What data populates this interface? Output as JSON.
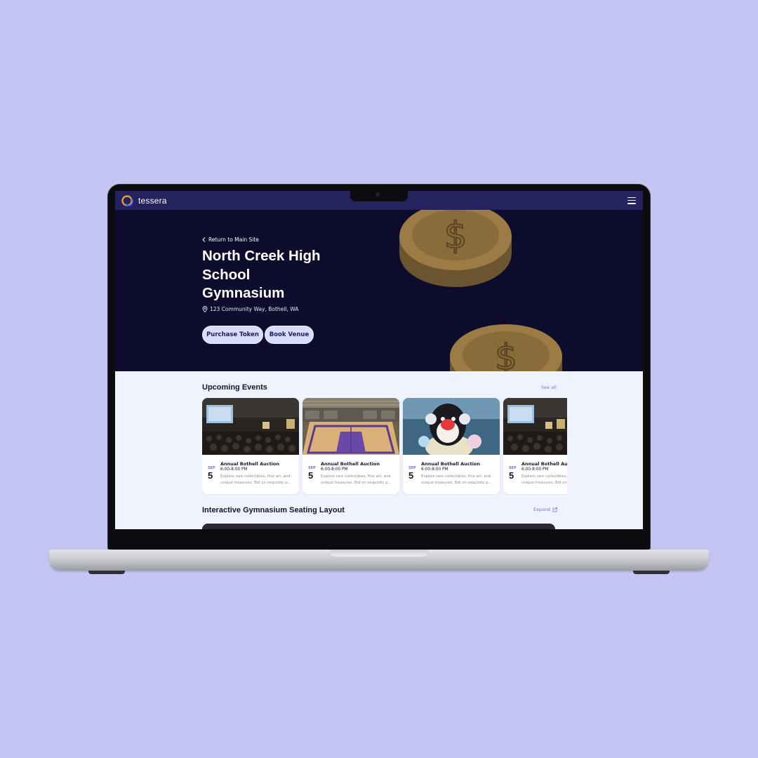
{
  "brand": {
    "name": "tessera"
  },
  "hero": {
    "back_link": "Return to Main Site",
    "title": "North Creek High School Gymnasium",
    "address": "123 Community Way, Bothell, WA",
    "buttons": {
      "purchase_token": "Purchase Token",
      "book_venue": "Book Venue"
    }
  },
  "events": {
    "heading": "Upcoming Events",
    "see_all": "See all",
    "items": [
      {
        "month": "SEP",
        "day": "5",
        "title": "Annual Bothell Auction",
        "time": "6:00-8:00 PM",
        "description": "Explore rare collectibles, fine art, and unique treasures. Bid on exquisite p...",
        "image": "auction-hall-photo"
      },
      {
        "month": "SEP",
        "day": "5",
        "title": "Annual Bothell Auction",
        "time": "6:00-8:00 PM",
        "description": "Explore rare collectibles, fine art, and unique treasures. Bid on exquisite p...",
        "image": "gymnasium-court-photo"
      },
      {
        "month": "SEP",
        "day": "5",
        "title": "Annual Bothell Auction",
        "time": "6:00-8:00 PM",
        "description": "Explore rare collectibles, fine art, and unique treasures. Bid on exquisite p...",
        "image": "penguin-plush-photo"
      },
      {
        "month": "SEP",
        "day": "5",
        "title": "Annual Bothell Auction",
        "time": "6:00-8:00 PM",
        "description": "Explore rare collectibles, fine art, and unique treasures. Bid on exquisite p...",
        "image": "auction-hall-photo"
      }
    ]
  },
  "seating": {
    "heading": "Interactive Gymnasium Seating Layout",
    "expand": "Expand"
  },
  "colors": {
    "page_background": "#c4c4f3",
    "navbar": "#24235e",
    "hero_background": "#0d0c2c",
    "button_fill": "#d7dcfb",
    "accent": "#7570d8",
    "content_background": "#eef3fd"
  }
}
